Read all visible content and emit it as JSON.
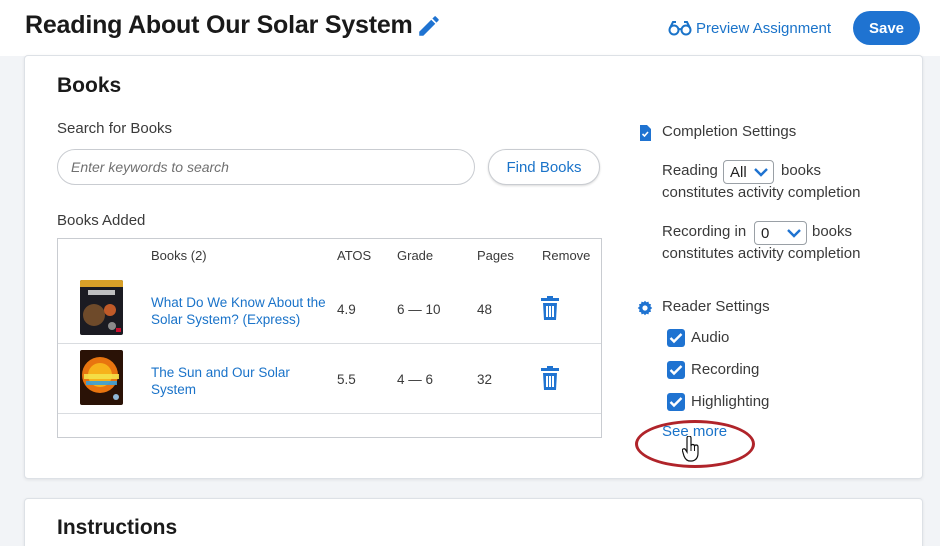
{
  "header": {
    "title": "Reading About Our Solar System",
    "preview_label": "Preview Assignment",
    "save_label": "Save"
  },
  "books_section": {
    "title": "Books",
    "search_label": "Search for Books",
    "search_placeholder": "Enter keywords to search",
    "search_value": "",
    "find_button": "Find Books",
    "added_label": "Books Added",
    "columns": [
      "Books (2)",
      "ATOS",
      "Grade",
      "Pages",
      "Remove"
    ],
    "rows": [
      {
        "title": "What Do We Know About the Solar System? (Express)",
        "atos": "4.9",
        "grade": "6 — 10",
        "pages": "48",
        "cover_text": "WHAT DO WE KNOW ABOUT THE SOLAR SYSTEM?"
      },
      {
        "title": "The Sun and Our Solar System",
        "atos": "5.5",
        "grade": "4 — 6",
        "pages": "32",
        "cover_text": "Sun & Solar System"
      }
    ]
  },
  "completion_settings": {
    "title": "Completion Settings",
    "reading_prefix": "Reading",
    "reading_value": "All",
    "reading_suffix": "books",
    "reading_line2": "constitutes activity completion",
    "recording_prefix": "Recording in",
    "recording_value": "0",
    "recording_suffix": "books",
    "recording_line2": "constitutes activity completion"
  },
  "reader_settings": {
    "title": "Reader Settings",
    "options": [
      {
        "label": "Audio",
        "checked": true
      },
      {
        "label": "Recording",
        "checked": true
      },
      {
        "label": "Highlighting",
        "checked": true
      }
    ],
    "see_more": "See more"
  },
  "instructions_section": {
    "title": "Instructions"
  },
  "colors": {
    "accent": "#1f73d1",
    "link": "#1a73c9",
    "highlight_ring": "#b0242a"
  }
}
